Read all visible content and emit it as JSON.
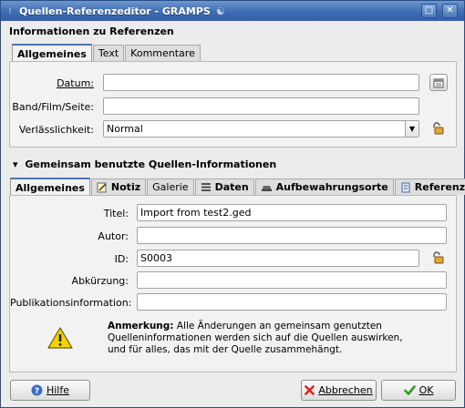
{
  "window": {
    "title": "Quellen-Referenzeditor - GRAMPS",
    "maximize_symbol": "□",
    "close_symbol": "✕"
  },
  "reference_section": {
    "title": "Informationen zu Referenzen",
    "tabs": [
      {
        "label": "Allgemeines",
        "active": true
      },
      {
        "label": "Text",
        "active": false
      },
      {
        "label": "Kommentare",
        "active": false
      }
    ],
    "date_label": "Datum:",
    "date_value": "",
    "volume_label": "Band/Film/Seite:",
    "volume_value": "",
    "confidence_label": "Verlässlichkeit:",
    "confidence_value": "Normal"
  },
  "shared_section": {
    "title": "Gemeinsam benutzte Quellen-Informationen",
    "expander_symbol": "▾",
    "tabs": [
      {
        "label": "Allgemeines",
        "active": true,
        "icon": ""
      },
      {
        "label": "Notiz",
        "active": false,
        "icon": "note-icon"
      },
      {
        "label": "Galerie",
        "active": false,
        "icon": ""
      },
      {
        "label": "Daten",
        "active": false,
        "icon": "data-icon"
      },
      {
        "label": "Aufbewahrungsorte",
        "active": false,
        "icon": "repository-icon"
      },
      {
        "label": "Referenzen",
        "active": false,
        "icon": "references-icon"
      }
    ],
    "title_label": "Titel:",
    "title_value": "Import from test2.ged",
    "author_label": "Autor:",
    "author_value": "",
    "id_label": "ID:",
    "id_value": "S0003",
    "abbrev_label": "Abkürzung:",
    "abbrev_value": "",
    "pubinfo_label": "Publikationsinformation:",
    "pubinfo_value": "",
    "note_bold": "Anmerkung:",
    "note_line1": " Alle Änderungen an gemeinsam genutzten",
    "note_line2": "Quelleninformationen werden sich auf die Quellen auswirken,",
    "note_line3": "und für alles, das mit der Quelle zusammehängt."
  },
  "buttons": {
    "help": "Hilfe",
    "cancel": "Abbrechen",
    "ok": "OK"
  },
  "colors": {
    "titlebar": "#3e6cb2",
    "warning": "#f5d400",
    "ok_check": "#2e9a1e",
    "cancel_x": "#d8261c",
    "help_blue": "#3b6fc9"
  }
}
